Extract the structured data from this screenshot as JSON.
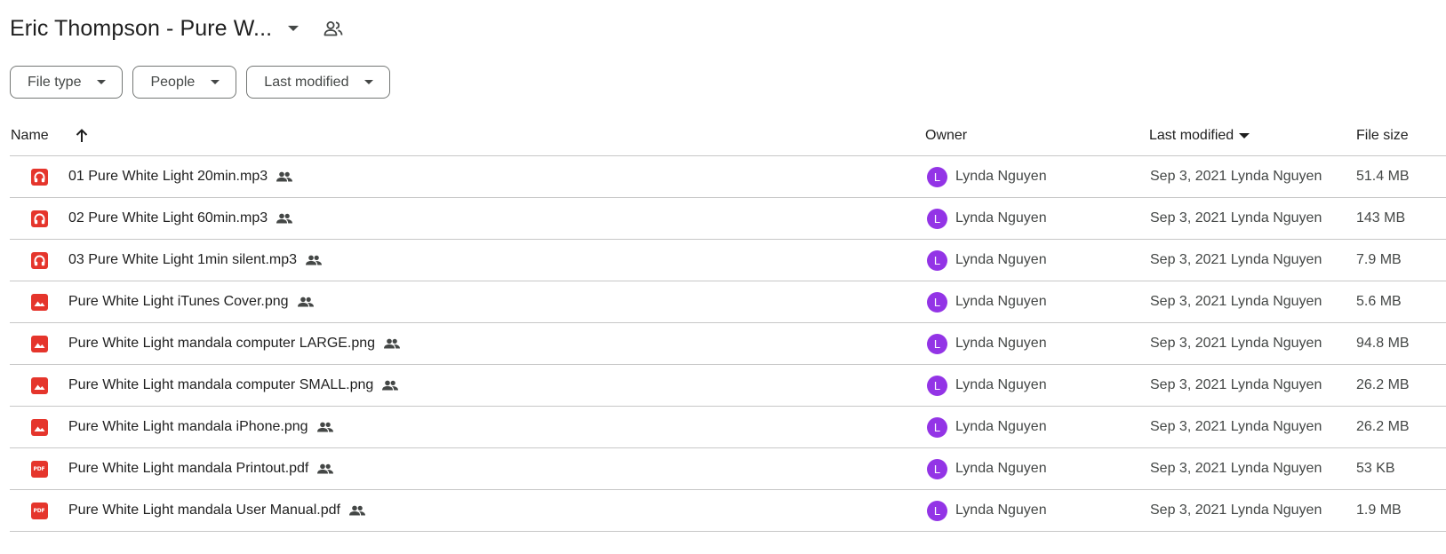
{
  "header": {
    "title": "Eric Thompson - Pure W..."
  },
  "filters": [
    {
      "label": "File type"
    },
    {
      "label": "People"
    },
    {
      "label": "Last modified"
    }
  ],
  "columns": {
    "name": "Name",
    "owner": "Owner",
    "modified": "Last modified",
    "size": "File size"
  },
  "files": [
    {
      "name": "01 Pure White Light 20min.mp3",
      "type": "audio-icon",
      "owner_initial": "L",
      "owner": "Lynda Nguyen",
      "modified": "Sep 3, 2021 Lynda Nguyen",
      "size": "51.4 MB"
    },
    {
      "name": "02 Pure White Light 60min.mp3",
      "type": "audio-icon",
      "owner_initial": "L",
      "owner": "Lynda Nguyen",
      "modified": "Sep 3, 2021 Lynda Nguyen",
      "size": "143 MB"
    },
    {
      "name": "03 Pure White Light 1min silent.mp3",
      "type": "audio-icon",
      "owner_initial": "L",
      "owner": "Lynda Nguyen",
      "modified": "Sep 3, 2021 Lynda Nguyen",
      "size": "7.9 MB"
    },
    {
      "name": "Pure White Light iTunes Cover.png",
      "type": "image-icon",
      "owner_initial": "L",
      "owner": "Lynda Nguyen",
      "modified": "Sep 3, 2021 Lynda Nguyen",
      "size": "5.6 MB"
    },
    {
      "name": "Pure White Light mandala computer LARGE.png",
      "type": "image-icon",
      "owner_initial": "L",
      "owner": "Lynda Nguyen",
      "modified": "Sep 3, 2021 Lynda Nguyen",
      "size": "94.8 MB"
    },
    {
      "name": "Pure White Light mandala computer SMALL.png",
      "type": "image-icon",
      "owner_initial": "L",
      "owner": "Lynda Nguyen",
      "modified": "Sep 3, 2021 Lynda Nguyen",
      "size": "26.2 MB"
    },
    {
      "name": "Pure White Light mandala iPhone.png",
      "type": "image-icon",
      "owner_initial": "L",
      "owner": "Lynda Nguyen",
      "modified": "Sep 3, 2021 Lynda Nguyen",
      "size": "26.2 MB"
    },
    {
      "name": "Pure White Light mandala Printout.pdf",
      "type": "pdf-icon",
      "type_label": "PDF",
      "owner_initial": "L",
      "owner": "Lynda Nguyen",
      "modified": "Sep 3, 2021 Lynda Nguyen",
      "size": "53 KB"
    },
    {
      "name": "Pure White Light mandala User Manual.pdf",
      "type": "pdf-icon",
      "type_label": "PDF",
      "owner_initial": "L",
      "owner": "Lynda Nguyen",
      "modified": "Sep 3, 2021 Lynda Nguyen",
      "size": "1.9 MB"
    }
  ],
  "colors": {
    "accent_red": "#e5352c",
    "avatar_purple": "#9334e6"
  }
}
